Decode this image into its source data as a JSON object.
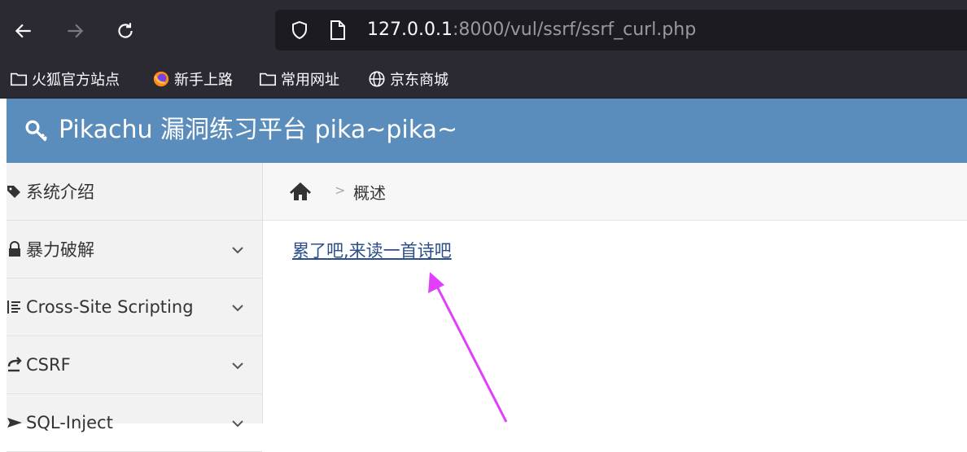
{
  "browser": {
    "url_host": "127.0.0.1",
    "url_rest": ":8000/vul/ssrf/ssrf_curl.php"
  },
  "bookmarks": [
    {
      "label": "火狐官方站点",
      "icon": "folder-icon"
    },
    {
      "label": "新手上路",
      "icon": "firefox-icon"
    },
    {
      "label": "常用网址",
      "icon": "folder-icon"
    },
    {
      "label": "京东商城",
      "icon": "globe-icon"
    }
  ],
  "header": {
    "title": "Pikachu 漏洞练习平台 pika~pika~"
  },
  "sidebar": {
    "items": [
      {
        "label": "系统介绍",
        "icon": "tags-icon"
      },
      {
        "label": "暴力破解",
        "icon": "lock-icon"
      },
      {
        "label": "Cross-Site Scripting",
        "icon": "list-icon"
      },
      {
        "label": "CSRF",
        "icon": "share-icon"
      },
      {
        "label": "SQL-Inject",
        "icon": "send-icon"
      }
    ]
  },
  "breadcrumb": {
    "current": "概述"
  },
  "content": {
    "link_text": "累了吧,来读一首诗吧"
  },
  "colors": {
    "toolbar": "#2b2a33",
    "header": "#5a8dbb",
    "sidebar": "#f2f2f2",
    "link": "#2c4f8a",
    "annotation_arrow": "#e040fb"
  }
}
